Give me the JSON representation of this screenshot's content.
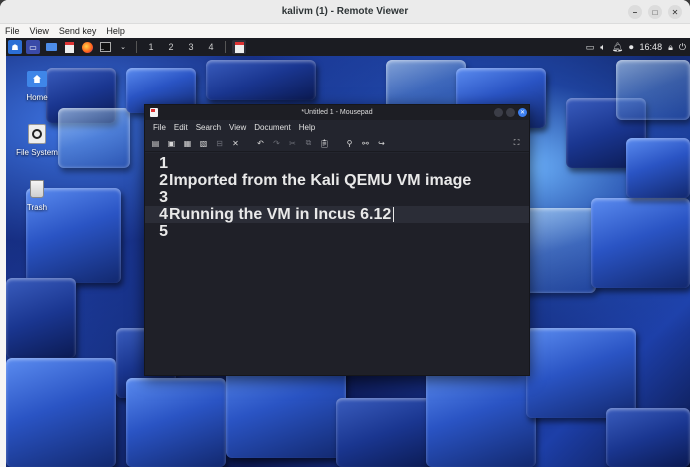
{
  "remote_viewer": {
    "title": "kalivm (1) - Remote Viewer",
    "menu": [
      "File",
      "View",
      "Send key",
      "Help"
    ]
  },
  "panel": {
    "workspaces": [
      "1",
      "2",
      "3",
      "4"
    ],
    "clock": "16:48"
  },
  "desktop_icons": [
    {
      "label": "Home",
      "icon": "home-folder-icon"
    },
    {
      "label": "File System",
      "icon": "drive-icon"
    },
    {
      "label": "Trash",
      "icon": "trash-icon"
    }
  ],
  "mousepad": {
    "title": "*Untitled 1 - Mousepad",
    "menu": [
      "File",
      "Edit",
      "Search",
      "View",
      "Document",
      "Help"
    ],
    "lines": [
      {
        "num": "1",
        "text": ""
      },
      {
        "num": "2",
        "text": "Imported from the Kali QEMU VM image"
      },
      {
        "num": "3",
        "text": ""
      },
      {
        "num": "4",
        "text": "Running the VM in Incus 6.12"
      },
      {
        "num": "5",
        "text": ""
      }
    ],
    "current_line": 4
  },
  "colors": {
    "editor_bg": "#1f2028",
    "panel_bg": "#1b1c22",
    "close_button": "#3c7ff0"
  }
}
